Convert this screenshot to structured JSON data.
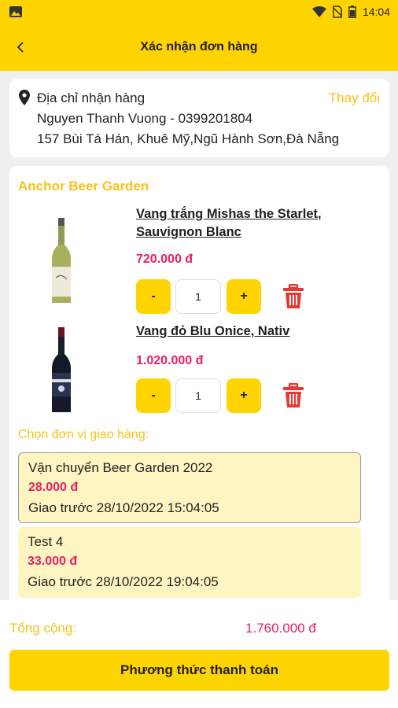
{
  "status_bar": {
    "time": "14:04",
    "icons": [
      "gallery-icon",
      "wifi-icon",
      "no-sim-icon",
      "battery-icon"
    ]
  },
  "header": {
    "back_icon": "chevron-left-icon",
    "title": "Xác nhận đơn hàng"
  },
  "address": {
    "icon": "location-pin-icon",
    "label": "Địa chỉ nhận hàng",
    "change_label": "Thay đổi",
    "recipient": "Nguyen Thanh Vuong - 0399201804",
    "street": "157 Bùi Tá Hán, Khuê Mỹ,Ngũ Hành Sơn,Đà Nẵng"
  },
  "order": {
    "shop_name": "Anchor Beer Garden",
    "items": [
      {
        "name_line1": "Vang trắng Mishas the Starlet,",
        "name_line2": "Sauvignon Blanc",
        "price": "720.000 đ",
        "qty": "1",
        "minus": "-",
        "plus": "+",
        "image": "white-wine-bottle"
      },
      {
        "name_line1": "Vang đỏ Blu Onice, Nativ",
        "price": "1.020.000 đ",
        "qty": "1",
        "minus": "-",
        "plus": "+",
        "image": "red-wine-bottle"
      }
    ],
    "shipping_label": "Chọn đơn vị giao hàng:",
    "shipping_options": [
      {
        "name": "Vận chuyển Beer Garden 2022",
        "price": "28.000 đ",
        "time": "Giao trước 28/10/2022 15:04:05",
        "selected": true
      },
      {
        "name": "Test 4",
        "price": "33.000 đ",
        "time": "Giao trước 28/10/2022 19:04:05",
        "selected": false
      }
    ]
  },
  "footer": {
    "total_label": "Tổng cộng:",
    "total_value": "1.760.000 đ",
    "pay_button": "Phương thức thanh toán"
  },
  "colors": {
    "primary": "#ffd400",
    "accent_text": "#f6c21c",
    "price": "#e91e63",
    "delete": "#e53935",
    "shipping_bg": "#fff5c2"
  }
}
